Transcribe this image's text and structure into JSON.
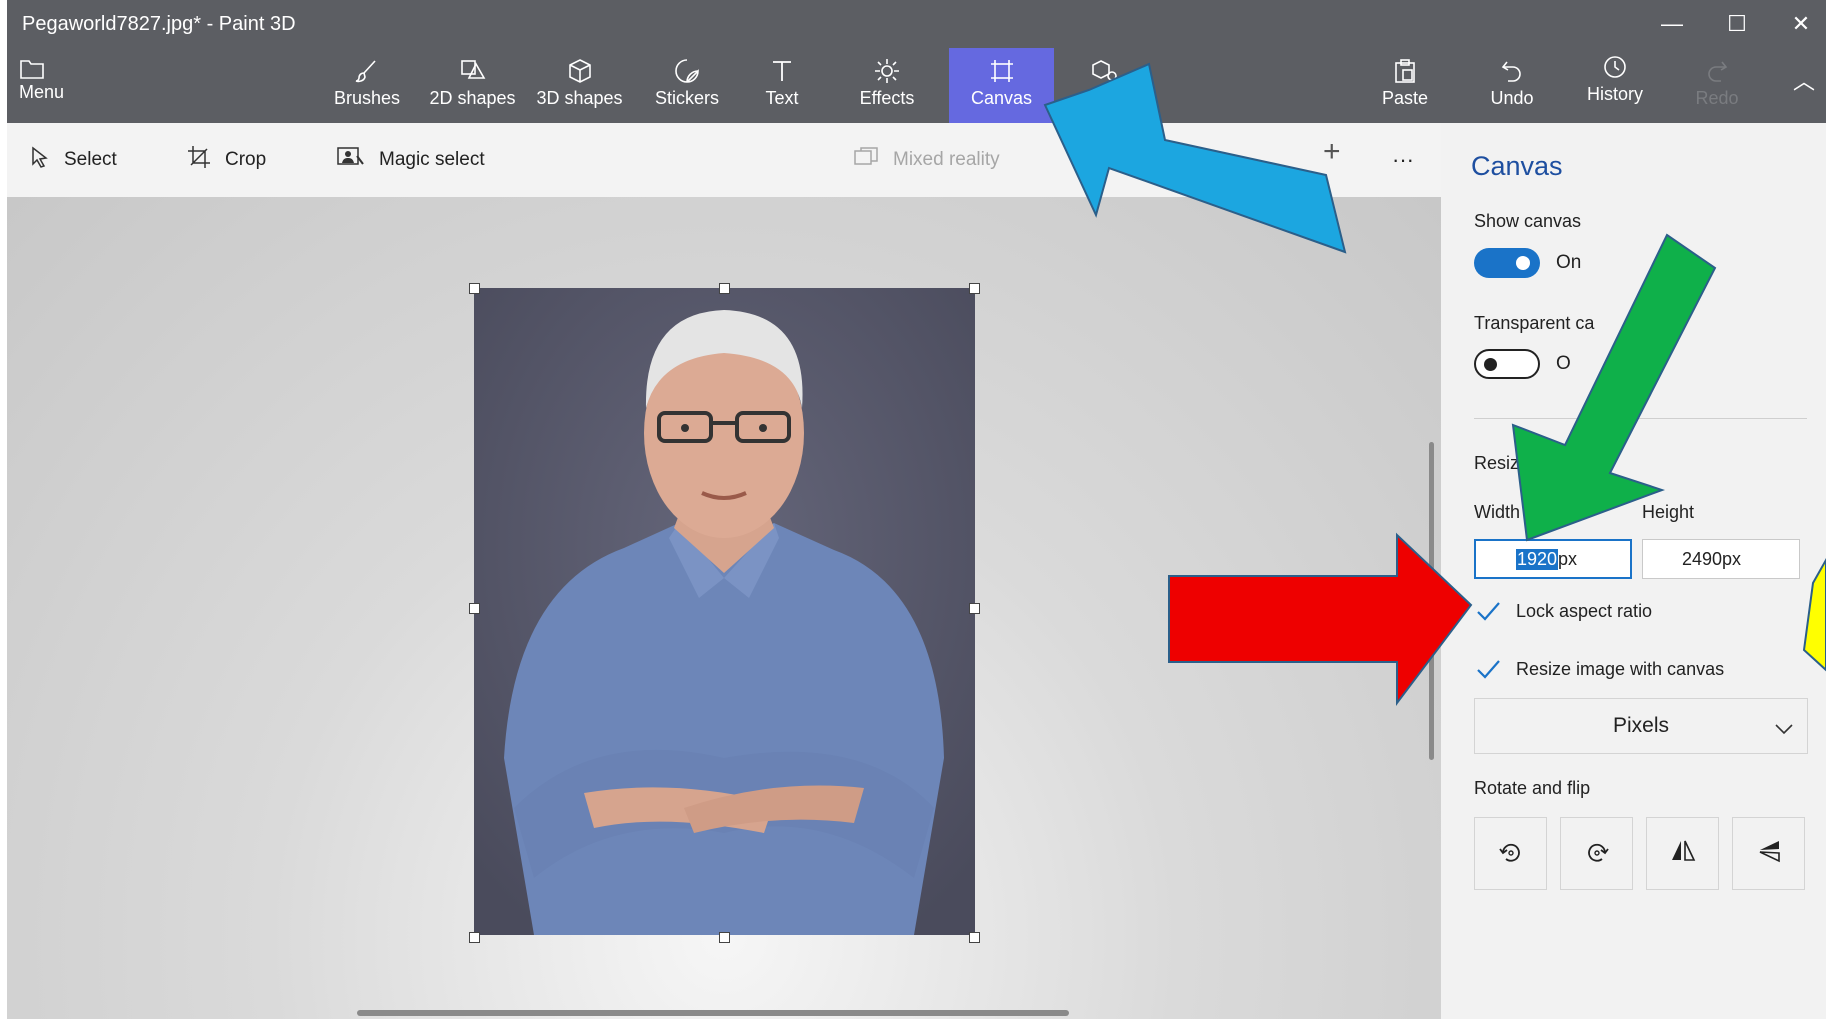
{
  "window": {
    "title": "Pegaworld7827.jpg* - Paint 3D",
    "minimize_glyph": "—",
    "maximize_glyph": "☐",
    "close_glyph": "✕"
  },
  "ribbon": {
    "menu_label": "Menu",
    "brushes_label": "Brushes",
    "shapes2d_label": "2D shapes",
    "shapes3d_label": "3D shapes",
    "stickers_label": "Stickers",
    "text_label": "Text",
    "effects_label": "Effects",
    "canvas_label": "Canvas",
    "paste_label": "Paste",
    "undo_label": "Undo",
    "history_label": "History",
    "redo_label": "Redo",
    "collapse_glyph": "︿"
  },
  "toolbar": {
    "select_label": "Select",
    "crop_label": "Crop",
    "magic_select_label": "Magic select",
    "mixed_reality_label": "Mixed reality",
    "more_glyph": "···",
    "zoom_plus_glyph": "+"
  },
  "panel": {
    "title": "Canvas",
    "show_canvas_label": "Show canvas",
    "show_canvas_state": "On",
    "transparent_label": "Transparent ca",
    "transparent_state": "O",
    "resize_label": "Resiz",
    "width_label": "Width",
    "height_label": "Height",
    "width_value": "1920",
    "width_unit": "px",
    "height_value": "2490",
    "height_unit": "px",
    "lock_aspect_label": "Lock aspect ratio",
    "resize_image_label": "Resize image with canvas",
    "units_value": "Pixels",
    "rotate_flip_label": "Rotate and flip"
  },
  "colors": {
    "accent": "#6569e0",
    "toggle_blue": "#1a73c8",
    "arrow_blue": "#1ca6e0",
    "arrow_green": "#0fb04a",
    "arrow_red": "#ee0000",
    "arrow_yellow": "#ffff00"
  }
}
